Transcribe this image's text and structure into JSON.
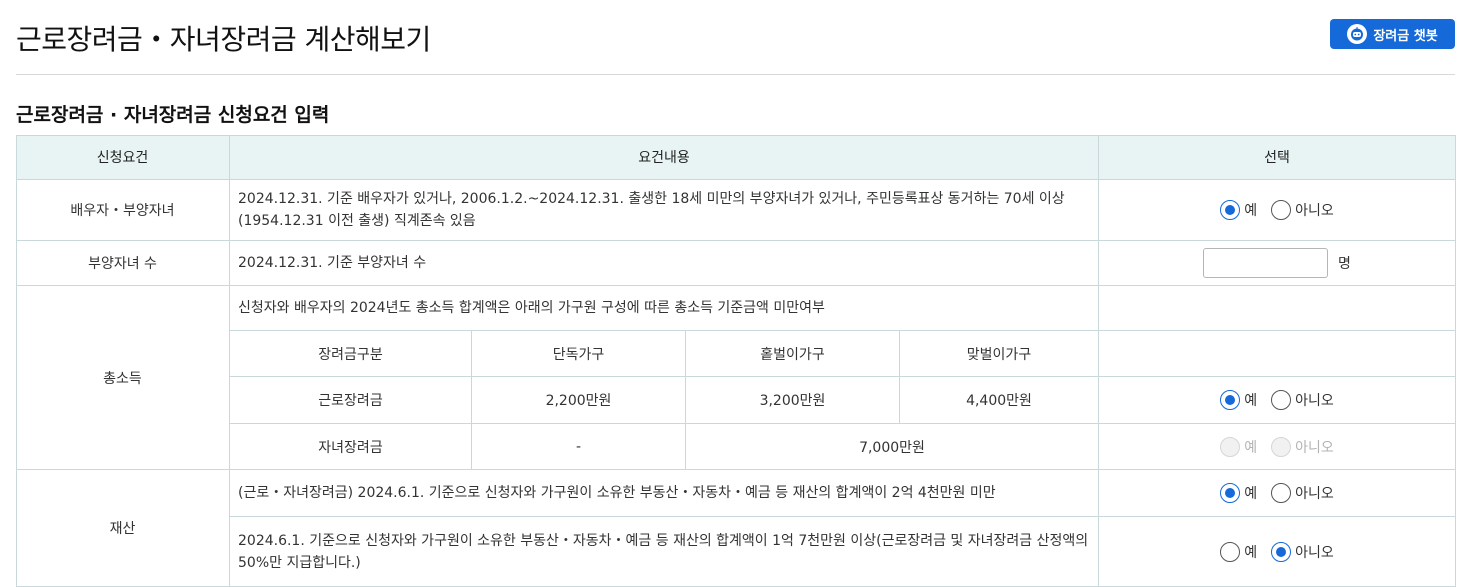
{
  "page_title": "근로장려금・자녀장려금 계산해보기",
  "chatbot_button": {
    "label": "장려금 챗봇",
    "icon": "chatbot-icon"
  },
  "section_title": "근로장려금 · 자녀장려금 신청요건 입력",
  "table_headers": {
    "requirement": "신청요건",
    "content": "요건내용",
    "select": "선택"
  },
  "rows": {
    "spouse": {
      "label": "배우자・부양자녀",
      "content": "2024.12.31. 기준 배우자가 있거나, 2006.1.2.~2024.12.31. 출생한 18세 미만의 부양자녀가 있거나, 주민등록표상 동거하는 70세 이상(1954.12.31 이전 출생) 직계존속 있음",
      "yes": "예",
      "no": "아니오",
      "selected": "예"
    },
    "children": {
      "label": "부양자녀 수",
      "content": "2024.12.31. 기준 부양자녀 수",
      "input_value": "",
      "unit": "명"
    },
    "income": {
      "label": "총소득",
      "content": "신청자와 배우자의 2024년도 총소득 합계액은 아래의 가구원 구성에 따른 총소득 기준금액 미만여부",
      "sub_headers": [
        "장려금구분",
        "단독가구",
        "홑벌이가구",
        "맞벌이가구"
      ],
      "earned": {
        "name": "근로장려금",
        "single": "2,200만원",
        "single_earner": "3,200만원",
        "dual_earner": "4,400만원",
        "yes": "예",
        "no": "아니오",
        "selected": "예"
      },
      "child": {
        "name": "자녀장려금",
        "single": "-",
        "combined": "7,000만원",
        "yes": "예",
        "no": "아니오",
        "disabled": true
      }
    },
    "property": {
      "label": "재산",
      "item1": {
        "content": "(근로・자녀장려금) 2024.6.1. 기준으로 신청자와 가구원이 소유한 부동산・자동차・예금 등 재산의 합계액이 2억 4천만원 미만",
        "yes": "예",
        "no": "아니오",
        "selected": "예"
      },
      "item2": {
        "content": "2024.6.1. 기준으로 신청자와 가구원이 소유한 부동산・자동차・예금 등 재산의 합계액이 1억 7천만원 이상(근로장려금 및 자녀장려금 산정액의 50%만 지급합니다.)",
        "yes": "예",
        "no": "아니오",
        "selected": "아니오"
      }
    }
  },
  "colors": {
    "accent": "#1669d9",
    "header_bg": "#e8f4f3",
    "border": "#c9d8da"
  }
}
